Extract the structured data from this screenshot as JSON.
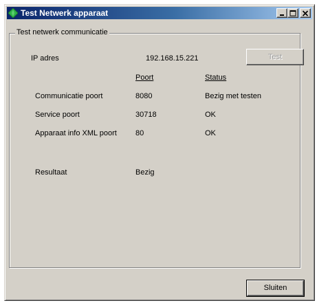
{
  "window": {
    "title": "Test Netwerk apparaat"
  },
  "group": {
    "legend": "Test netwerk communicatie"
  },
  "ip": {
    "label": "IP adres",
    "value": "192.168.15.221"
  },
  "test_button": {
    "label": "Test",
    "enabled": false
  },
  "columns": {
    "port": "Poort",
    "status": "Status"
  },
  "rows": [
    {
      "label": "Communicatie poort",
      "port": "8080",
      "status": "Bezig met testen"
    },
    {
      "label": "Service poort",
      "port": "30718",
      "status": "OK"
    },
    {
      "label": "Apparaat info XML poort",
      "port": "80",
      "status": "OK"
    }
  ],
  "result": {
    "label": "Resultaat",
    "value": "Bezig"
  },
  "close_button": {
    "label": "Sluiten"
  },
  "icons": {
    "app": "green-diamond-icon",
    "minimize": "minimize-icon",
    "maximize": "maximize-icon",
    "close": "close-icon"
  },
  "colors": {
    "titlebar_start": "#0a246a",
    "titlebar_end": "#a6caf0",
    "face": "#d4d0c8",
    "app_icon": "#2fb34a"
  }
}
